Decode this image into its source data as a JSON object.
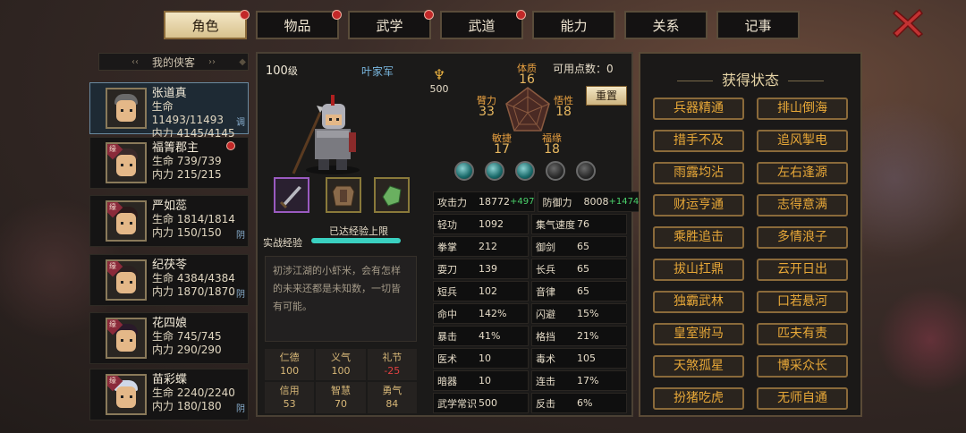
{
  "tabs": [
    {
      "label": "角色",
      "active": true,
      "badge": true
    },
    {
      "label": "物品",
      "active": false,
      "badge": true
    },
    {
      "label": "武学",
      "active": false,
      "badge": true
    },
    {
      "label": "武道",
      "active": false,
      "badge": true
    },
    {
      "label": "能力",
      "active": false,
      "badge": false
    },
    {
      "label": "关系",
      "active": false,
      "badge": false
    },
    {
      "label": "记事",
      "active": false,
      "badge": false
    }
  ],
  "list_title": "我的侠客",
  "characters": [
    {
      "name": "张道真",
      "hp": "生命 11493/11493",
      "mp": "内力 4145/4145",
      "tag": "调",
      "fate": "",
      "alert": false,
      "selected": true
    },
    {
      "name": "福箐郡主",
      "hp": "生命 739/739",
      "mp": "内力 215/215",
      "tag": "",
      "fate": "缘",
      "alert": true,
      "selected": false
    },
    {
      "name": "严如蕊",
      "hp": "生命 1814/1814",
      "mp": "内力 150/150",
      "tag": "阴",
      "fate": "缘",
      "alert": false,
      "selected": false
    },
    {
      "name": "纪茯苓",
      "hp": "生命 4384/4384",
      "mp": "内力 1870/1870",
      "tag": "阴",
      "fate": "缘",
      "alert": false,
      "selected": false
    },
    {
      "name": "花四娘",
      "hp": "生命 745/745",
      "mp": "内力 290/290",
      "tag": "",
      "fate": "缘",
      "alert": false,
      "selected": false
    },
    {
      "name": "苗彩蝶",
      "hp": "生命 2240/2240",
      "mp": "内力 180/180",
      "tag": "阴",
      "fate": "缘",
      "alert": false,
      "selected": false
    }
  ],
  "main": {
    "level": "100",
    "level_unit": "级",
    "faction": "叶家军",
    "power": "500",
    "available_points": "可用点数：0",
    "reset_label": "重置",
    "attrs": {
      "tizhi": {
        "label": "体质",
        "value": "16"
      },
      "bili": {
        "label": "臂力",
        "value": "33"
      },
      "wuxing": {
        "label": "悟性",
        "value": "18"
      },
      "minjie": {
        "label": "敏捷",
        "value": "17"
      },
      "fuyuan": {
        "label": "福缘",
        "value": "18"
      }
    },
    "exp_label": "实战经验",
    "exp_status": "已达经验上限",
    "exp_fill": 1.0,
    "description": "初涉江湖的小虾米，会有怎样的未来还都是未知数，一切皆有可能。",
    "virtues": [
      {
        "name": "仁德",
        "value": "100",
        "neg": false
      },
      {
        "name": "义气",
        "value": "100",
        "neg": false
      },
      {
        "name": "礼节",
        "value": "-25",
        "neg": true
      },
      {
        "name": "信用",
        "value": "53",
        "neg": false
      },
      {
        "name": "智慧",
        "value": "70",
        "neg": false
      },
      {
        "name": "勇气",
        "value": "84",
        "neg": false
      }
    ],
    "orbs": [
      true,
      true,
      true,
      false,
      false
    ],
    "stats": [
      [
        {
          "k": "攻击力",
          "v": "18772",
          "g": "+497"
        },
        {
          "k": "防御力",
          "v": "8008",
          "g": "+1474"
        }
      ],
      [
        {
          "k": "轻功",
          "v": "1092",
          "g": ""
        },
        {
          "k": "集气速度",
          "v": "76",
          "g": ""
        }
      ],
      [
        {
          "k": "拳掌",
          "v": "212",
          "g": ""
        },
        {
          "k": "御剑",
          "v": "65",
          "g": ""
        }
      ],
      [
        {
          "k": "耍刀",
          "v": "139",
          "g": ""
        },
        {
          "k": "长兵",
          "v": "65",
          "g": ""
        }
      ],
      [
        {
          "k": "短兵",
          "v": "102",
          "g": ""
        },
        {
          "k": "音律",
          "v": "65",
          "g": ""
        }
      ],
      [
        {
          "k": "命中",
          "v": "142%",
          "g": ""
        },
        {
          "k": "闪避",
          "v": "15%",
          "g": ""
        }
      ],
      [
        {
          "k": "暴击",
          "v": "41%",
          "g": ""
        },
        {
          "k": "格挡",
          "v": "21%",
          "g": ""
        }
      ],
      [
        {
          "k": "医术",
          "v": "10",
          "g": ""
        },
        {
          "k": "毒术",
          "v": "105",
          "g": ""
        }
      ],
      [
        {
          "k": "暗器",
          "v": "10",
          "g": ""
        },
        {
          "k": "连击",
          "v": "17%",
          "g": ""
        }
      ],
      [
        {
          "k": "武学常识",
          "v": "500",
          "g": ""
        },
        {
          "k": "反击",
          "v": "6%",
          "g": ""
        }
      ]
    ]
  },
  "status": {
    "title": "获得状态",
    "buffs": [
      "兵器精通",
      "排山倒海",
      "措手不及",
      "追风掣电",
      "雨露均沾",
      "左右逢源",
      "财运亨通",
      "志得意满",
      "乘胜追击",
      "多情浪子",
      "拔山扛鼎",
      "云开日出",
      "独霸武林",
      "口若悬河",
      "皇室驸马",
      "匹夫有责",
      "天煞孤星",
      "博采众长",
      "扮猪吃虎",
      "无师自通"
    ]
  },
  "colors": {
    "accent": "#e8a838",
    "selected": "#1e2a34",
    "exp": "#3ad0c0",
    "negative": "#e04040"
  }
}
